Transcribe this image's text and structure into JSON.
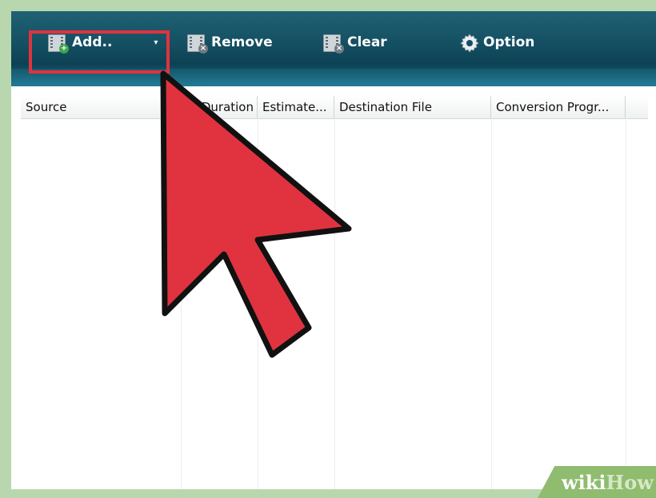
{
  "toolbar": {
    "add_label": "Add..",
    "remove_label": "Remove",
    "clear_label": "Clear",
    "option_label": "Option",
    "icons": {
      "add": "add-video-icon",
      "remove": "remove-video-icon",
      "clear": "clear-list-icon",
      "option": "gear-icon",
      "dropdown": "chevron-down-icon"
    }
  },
  "list": {
    "columns": [
      "Source",
      "Duration",
      "Estimate...",
      "Destination File",
      "Conversion Progr..."
    ],
    "rows": []
  },
  "overlay": {
    "highlight_color": "#e0333f",
    "cursor_color": "#e0333f"
  },
  "watermark": {
    "wiki": "wiki",
    "how": "How"
  }
}
